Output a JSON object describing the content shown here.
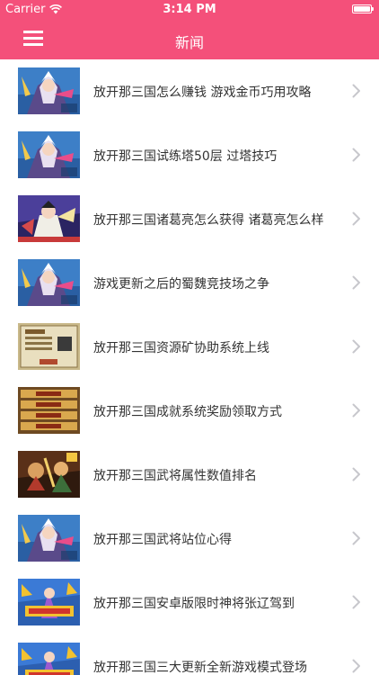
{
  "status_bar": {
    "carrier": "Carrier",
    "time": "3:14 PM"
  },
  "nav_bar": {
    "title": "新闻",
    "menu_icon": "hamburger-menu-icon",
    "color": "#f4507a"
  },
  "news": [
    {
      "title": "放开那三国怎么赚钱 游戏金币巧用攻略",
      "thumb": "warrior-art"
    },
    {
      "title": "放开那三国试练塔50层 过塔技巧",
      "thumb": "warrior-art"
    },
    {
      "title": "放开那三国诸葛亮怎么获得 诸葛亮怎么样",
      "thumb": "zhuge-art"
    },
    {
      "title": "游戏更新之后的蜀魏竞技场之争",
      "thumb": "warrior-art"
    },
    {
      "title": "放开那三国资源矿协助系统上线",
      "thumb": "parchment-ui"
    },
    {
      "title": "放开那三国成就系统奖励领取方式",
      "thumb": "reward-bars"
    },
    {
      "title": "放开那三国武将属性数值排名",
      "thumb": "battle-art"
    },
    {
      "title": "放开那三国武将站位心得",
      "thumb": "warrior-art"
    },
    {
      "title": "放开那三国安卓版限时神将张辽驾到",
      "thumb": "promo-banner"
    },
    {
      "title": "放开那三国三大更新全新游戏模式登场",
      "thumb": "promo-banner"
    }
  ]
}
